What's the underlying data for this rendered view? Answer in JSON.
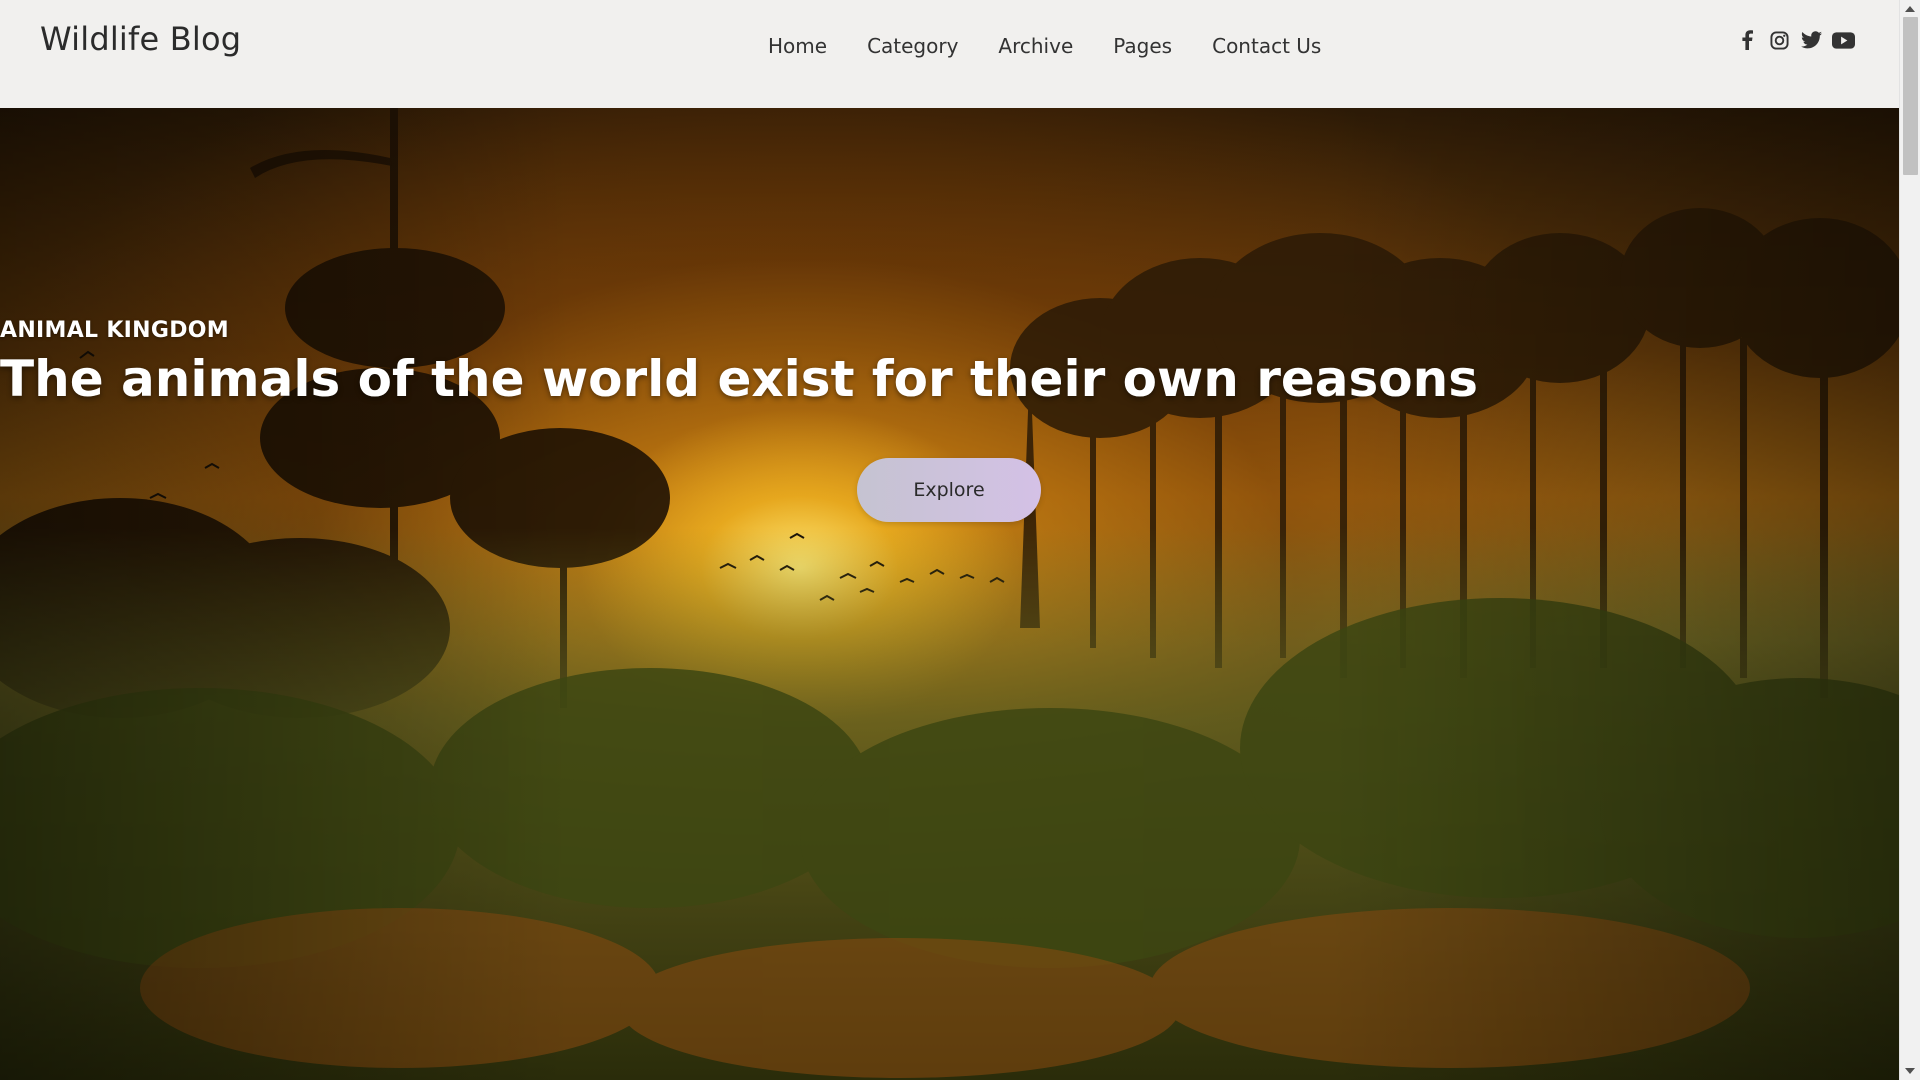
{
  "header": {
    "brand": "Wildlife Blog",
    "nav": [
      {
        "label": "Home"
      },
      {
        "label": "Category"
      },
      {
        "label": "Archive"
      },
      {
        "label": "Pages"
      },
      {
        "label": "Contact Us"
      }
    ],
    "socials": [
      "facebook-icon",
      "instagram-icon",
      "twitter-icon",
      "youtube-icon"
    ]
  },
  "hero": {
    "eyebrow": "ANIMAL KINGDOM",
    "headline": "The animals of the world exist for their own reasons",
    "button_label": "Explore",
    "button_gradient": [
      "#c5c3d1",
      "#d4c1e6"
    ]
  },
  "colors": {
    "header_bg": "#f1f0ee",
    "brand_text": "#2b2b2b",
    "hero_glow": "#ffd84a"
  }
}
